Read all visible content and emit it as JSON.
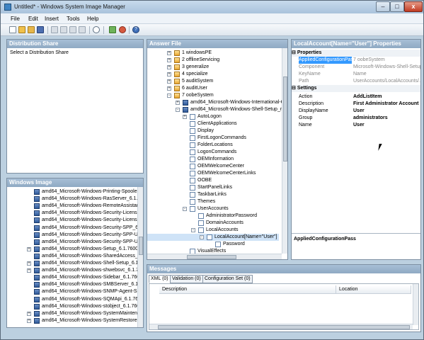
{
  "window": {
    "title": "Untitled* - Windows System Image Manager",
    "controls": {
      "minimize": "–",
      "maximize": "□",
      "close": "x"
    }
  },
  "menu": [
    "File",
    "Edit",
    "Insert",
    "Tools",
    "Help"
  ],
  "toolbar": [
    "new-icon",
    "open-icon",
    "open-folder-icon",
    "save-icon",
    "cut-icon",
    "copy-icon",
    "paste-icon",
    "delete-icon",
    "find-icon",
    "validate-icon",
    "create-configset-icon",
    "help-icon"
  ],
  "distribution_share": {
    "header": "Distribution Share",
    "placeholder": "Select a Distribution Share"
  },
  "windows_image": {
    "header": "Windows Image",
    "items": [
      "amd64_Microsoft-Windows-Printing-Spooler-(",
      "amd64_Microsoft-Windows-RasServer_6.1.7",
      "amd64_Microsoft-Windows-RemoteAssistanc",
      "amd64_Microsoft-Windows-Security-Licensin",
      "amd64_Microsoft-Windows-Security-Licensin",
      "amd64_Microsoft-Windows-Security-SPP_6.",
      "amd64_Microsoft-Windows-Security-SPP-UX",
      "amd64_Microsoft-Windows-Security-SPP-UX",
      "amd64_Microsoft-Windows-Setup_6.1.7600",
      "amd64_Microsoft-Windows-SharedAccess_6",
      "amd64_Microsoft-Windows-Shell-Setup_6.1.",
      "amd64_Microsoft-Windows-shwebsvc_6.1.76",
      "amd64_Microsoft-Windows-Sidebar_6.1.760",
      "amd64_Microsoft-Windows-SMBServer_6.1.",
      "amd64_Microsoft-Windows-SNMP-Agent-Ser",
      "amd64_Microsoft-Windows-SQMApi_6.1.760",
      "amd64_Microsoft-Windows-stobject_6.1.760",
      "amd64_Microsoft-Windows-SystemMaintena",
      "amd64_Microsoft-Windows-SystemRestore-M"
    ]
  },
  "answer_file": {
    "header": "Answer File",
    "passes": [
      "1 windowsPE",
      "2 offlineServicing",
      "3 generalize",
      "4 specialize",
      "5 auditSystem",
      "6 auditUser",
      "7 oobeSystem"
    ],
    "components": [
      "amd64_Microsoft-Windows-International-Co",
      "amd64_Microsoft-Windows-Shell-Setup_neu"
    ],
    "settings": [
      "AutoLogon",
      "ClientApplications",
      "Display",
      "FirstLogonCommands",
      "FolderLocations",
      "LogonCommands",
      "OEMInformation",
      "OEMWelcomeCenter",
      "OEMWelcomeCenterLinks",
      "OOBE",
      "StartPanelLinks",
      "TaskbarLinks",
      "Themes",
      "UserAccounts"
    ],
    "user_accounts_children": [
      "AdministratorPassword",
      "DomainAccounts",
      "LocalAccounts"
    ],
    "local_account": "LocalAccount[Name=\"User\"]",
    "password": "Password",
    "visual_effects": "VisualEffects"
  },
  "properties": {
    "header": "LocalAccount[Name=\"User\"] Properties",
    "categories": {
      "properties": "Properties",
      "settings": "Settings"
    },
    "readonly_rows": [
      {
        "key": "AppliedConfigurationPass",
        "value": "7 oobeSystem"
      },
      {
        "key": "Component",
        "value": "Microsoft-Windows-Shell-Setup"
      },
      {
        "key": "KeyName",
        "value": "Name"
      },
      {
        "key": "Path",
        "value": "UserAccounts/LocalAccounts/..."
      }
    ],
    "setting_rows": [
      {
        "key": "Action",
        "value": "AddListItem"
      },
      {
        "key": "Description",
        "value": "First Administrator Account"
      },
      {
        "key": "DisplayName",
        "value": "User"
      },
      {
        "key": "Group",
        "value": "administrators"
      },
      {
        "key": "Name",
        "value": "User"
      }
    ],
    "description_title": "AppliedConfigurationPass"
  },
  "messages": {
    "header": "Messages",
    "tabs": [
      "XML (0)",
      "Validation (0)",
      "Configuration Set (0)"
    ],
    "columns": [
      "Description",
      "Location"
    ]
  },
  "colors": {
    "pane_header": "#98b1ca",
    "selected_row": "#3399ff",
    "window_frame": "#bcd0e0"
  }
}
